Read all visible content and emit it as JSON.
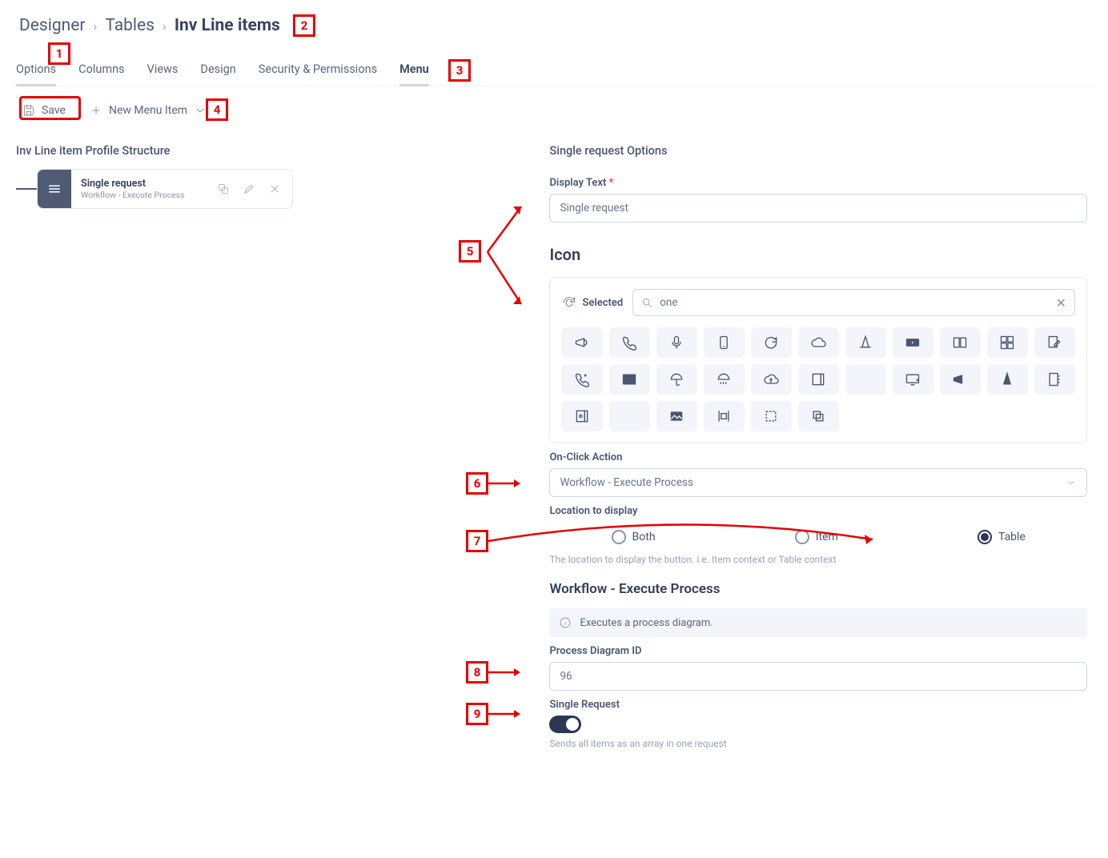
{
  "breadcrumb": {
    "root": "Designer",
    "mid": "Tables",
    "current": "Inv Line items"
  },
  "tabs": [
    "Options",
    "Columns",
    "Views",
    "Design",
    "Security & Permissions",
    "Menu"
  ],
  "active_tab": "Menu",
  "toolbar": {
    "save": "Save",
    "new": "New Menu Item"
  },
  "left": {
    "title": "Inv Line item Profile Structure",
    "node": {
      "title": "Single request",
      "subtitle": "Workflow - Execute Process"
    }
  },
  "right": {
    "title": "Single request Options",
    "display_text": {
      "label": "Display Text",
      "value": "Single request"
    },
    "icon": {
      "heading": "Icon",
      "selected": "Selected",
      "search": "one"
    },
    "onclick": {
      "label": "On-Click Action",
      "value": "Workflow - Execute Process"
    },
    "location": {
      "label": "Location to display",
      "opts": [
        "Both",
        "Item",
        "Table"
      ],
      "selected": "Table",
      "help": "The location to display the button. i.e. Item context or Table context"
    },
    "wf": {
      "heading": "Workflow - Execute Process",
      "info": "Executes a process diagram.",
      "pid": {
        "label": "Process Diagram ID",
        "value": "96"
      },
      "single": {
        "label": "Single Request",
        "help": "Sends all items as an array in one request"
      }
    }
  },
  "callouts": [
    "1",
    "2",
    "3",
    "4",
    "5",
    "6",
    "7",
    "8",
    "9"
  ]
}
